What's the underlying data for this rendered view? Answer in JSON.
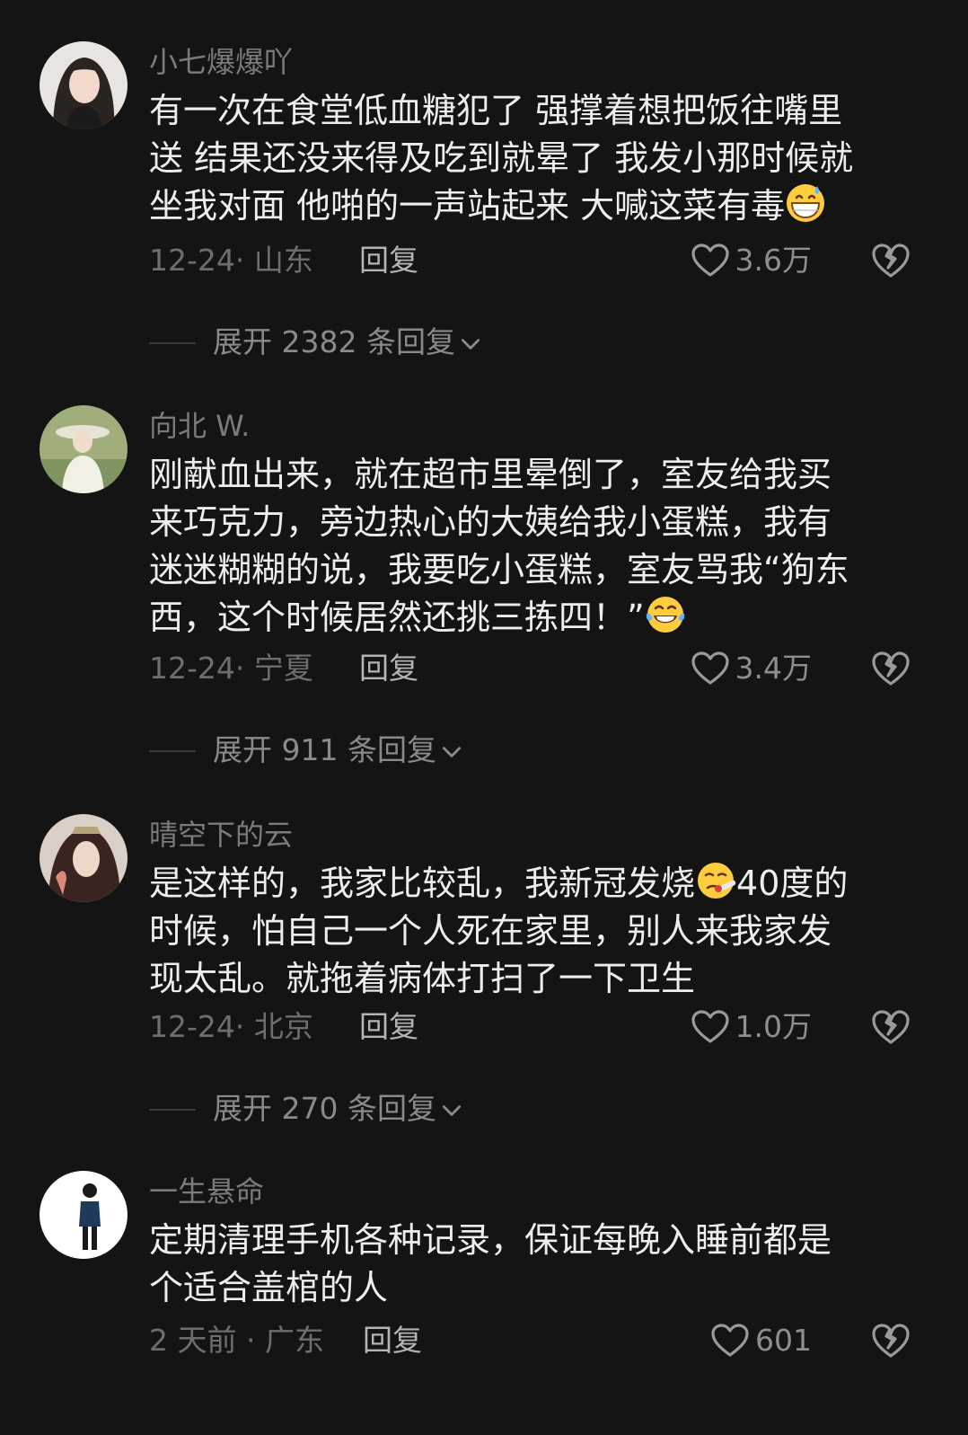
{
  "comments": [
    {
      "username": "小七爆爆吖",
      "lines": [
        "有一次在食堂低血糖犯了 强撑着想把饭往嘴里",
        "送 结果还没来得及吃到就晕了 我发小那时候就",
        "坐我对面 他啪的一声站起来 大喊这菜有毒"
      ],
      "emoji": "grinning-sweat-emoji",
      "time_location": "12-24· 山东",
      "reply_label": "回复",
      "likes": "3.6万",
      "expand_label": "展开 2382 条回复"
    },
    {
      "username": "向北 W.",
      "lines": [
        "刚献血出来，就在超市里晕倒了，室友给我买",
        "来巧克力，旁边热心的大姨给我小蛋糕，我有",
        "迷迷糊糊的说，我要吃小蛋糕，室友骂我“狗东",
        "西，这个时候居然还挑三拣四！”"
      ],
      "emoji": "tears-of-joy-emoji",
      "time_location": "12-24· 宁夏",
      "reply_label": "回复",
      "likes": "3.4万",
      "expand_label": "展开 911 条回复"
    },
    {
      "username": "晴空下的云",
      "lines_before_emoji": "是这样的，我家比较乱，我新冠发烧",
      "emoji": "thermometer-face-emoji",
      "lines_after_emoji": "40度的",
      "lines": [
        "时候，怕自己一个人死在家里，别人来我家发",
        "现太乱。就拖着病体打扫了一下卫生"
      ],
      "time_location": "12-24· 北京",
      "reply_label": "回复",
      "likes": "1.0万",
      "expand_label": "展开 270 条回复"
    },
    {
      "username": "一生悬命",
      "lines": [
        "定期清理手机各种记录，保证每晚入睡前都是",
        "个适合盖棺的人"
      ],
      "time_location": "2 天前 · 广东",
      "reply_label": "回复",
      "likes": "601"
    }
  ],
  "colors": {
    "background": "#141414",
    "text": "#ededed",
    "username": "#7b7b7b",
    "meta": "#6e6e6e"
  }
}
